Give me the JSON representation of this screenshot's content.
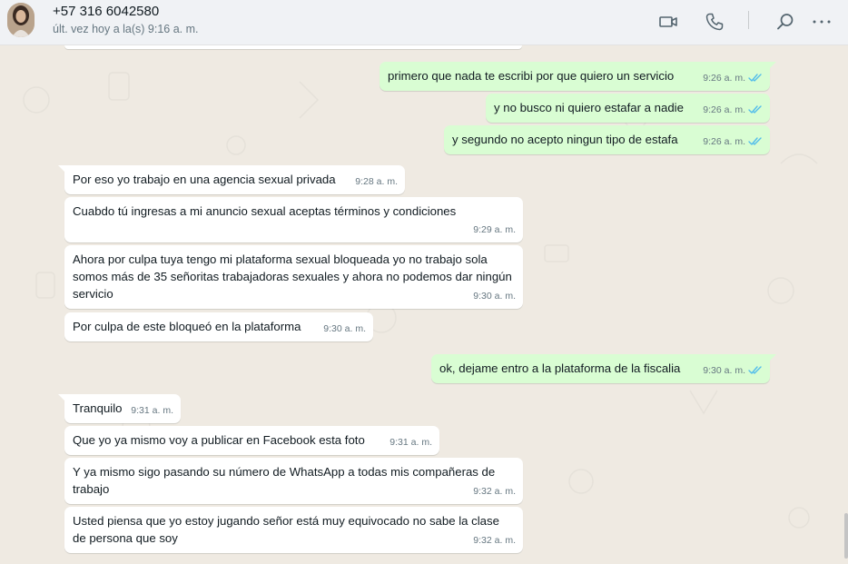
{
  "header": {
    "contact_name": "+57 316 6042580",
    "last_seen": "últ. vez hoy a la(s) 9:16 a. m.",
    "icons": [
      "video-call-icon",
      "voice-call-icon",
      "search-icon",
      "menu-icon"
    ]
  },
  "colors": {
    "incoming_bubble": "#ffffff",
    "outgoing_bubble": "#d9fdd3",
    "read_ticks": "#53bdeb",
    "chat_background": "#efeae2"
  },
  "messages": [
    {
      "direction": "out",
      "text": "primero que nada te escribi por que quiero un servicio",
      "time": "9:26 a. m.",
      "status": "read"
    },
    {
      "direction": "out",
      "text": "y no busco ni quiero estafar a nadie",
      "time": "9:26 a. m.",
      "status": "read"
    },
    {
      "direction": "out",
      "text": "y segundo no acepto ningun tipo de estafa",
      "time": "9:26 a. m.",
      "status": "read"
    },
    {
      "direction": "in",
      "text": "Por eso yo trabajo en una agencia sexual privada",
      "time": "9:28 a. m."
    },
    {
      "direction": "in",
      "text": "Cuabdo tú ingresas a mi anuncio sexual aceptas términos y condiciones",
      "time": "9:29 a. m."
    },
    {
      "direction": "in",
      "text": "Ahora por culpa tuya tengo mi plataforma sexual bloqueada yo no trabajo sola somos más de 35 señoritas trabajadoras sexuales y ahora no podemos dar ningún servicio",
      "time": "9:30 a. m."
    },
    {
      "direction": "in",
      "text": "Por culpa de este bloqueó en la plataforma",
      "time": "9:30 a. m."
    },
    {
      "direction": "out",
      "text": "ok, dejame entro a la plataforma de la fiscalia",
      "time": "9:30 a. m.",
      "status": "read"
    },
    {
      "direction": "in",
      "text": "Tranquilo",
      "time": "9:31 a. m."
    },
    {
      "direction": "in",
      "text": "Que yo ya mismo voy a publicar en Facebook esta foto",
      "time": "9:31 a. m."
    },
    {
      "direction": "in",
      "text": "Y ya mismo sigo pasando su número de WhatsApp a todas mis compañeras de trabajo",
      "time": "9:32 a. m."
    },
    {
      "direction": "in",
      "text": "Usted piensa que yo estoy jugando señor está muy equivocado no sabe la clase de persona que soy",
      "time": "9:32 a. m."
    }
  ]
}
